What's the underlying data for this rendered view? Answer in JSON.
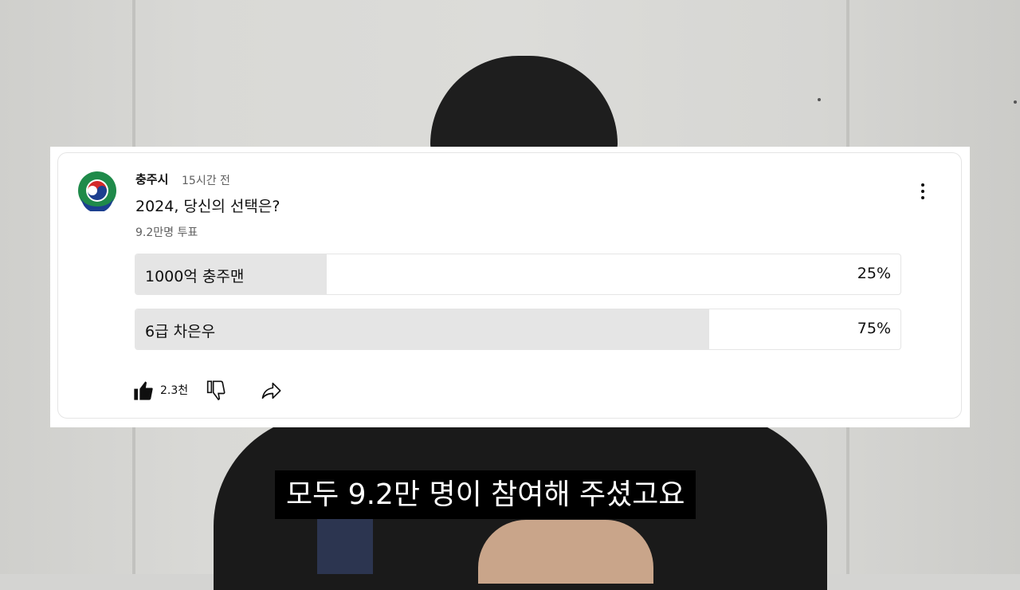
{
  "post": {
    "channel": "충주시",
    "time": "15시간 전",
    "question": "2024, 당신의 선택은?",
    "votes": "9.2만명 투표",
    "options": [
      {
        "label": "1000억 충주맨",
        "percent_text": "25%",
        "percent": 25
      },
      {
        "label": "6급 차은우",
        "percent_text": "75%",
        "percent": 75
      }
    ],
    "likes": "2.3천",
    "icons": [
      "more-vert-icon",
      "thumb-up-icon",
      "thumb-down-icon",
      "share-icon"
    ],
    "colors": {
      "bar_fill": "#e5e5e5",
      "text": "#0f0f0f",
      "secondary": "#606060"
    }
  },
  "subtitle": "모두 9.2만 명이 참여해 주셨고요"
}
